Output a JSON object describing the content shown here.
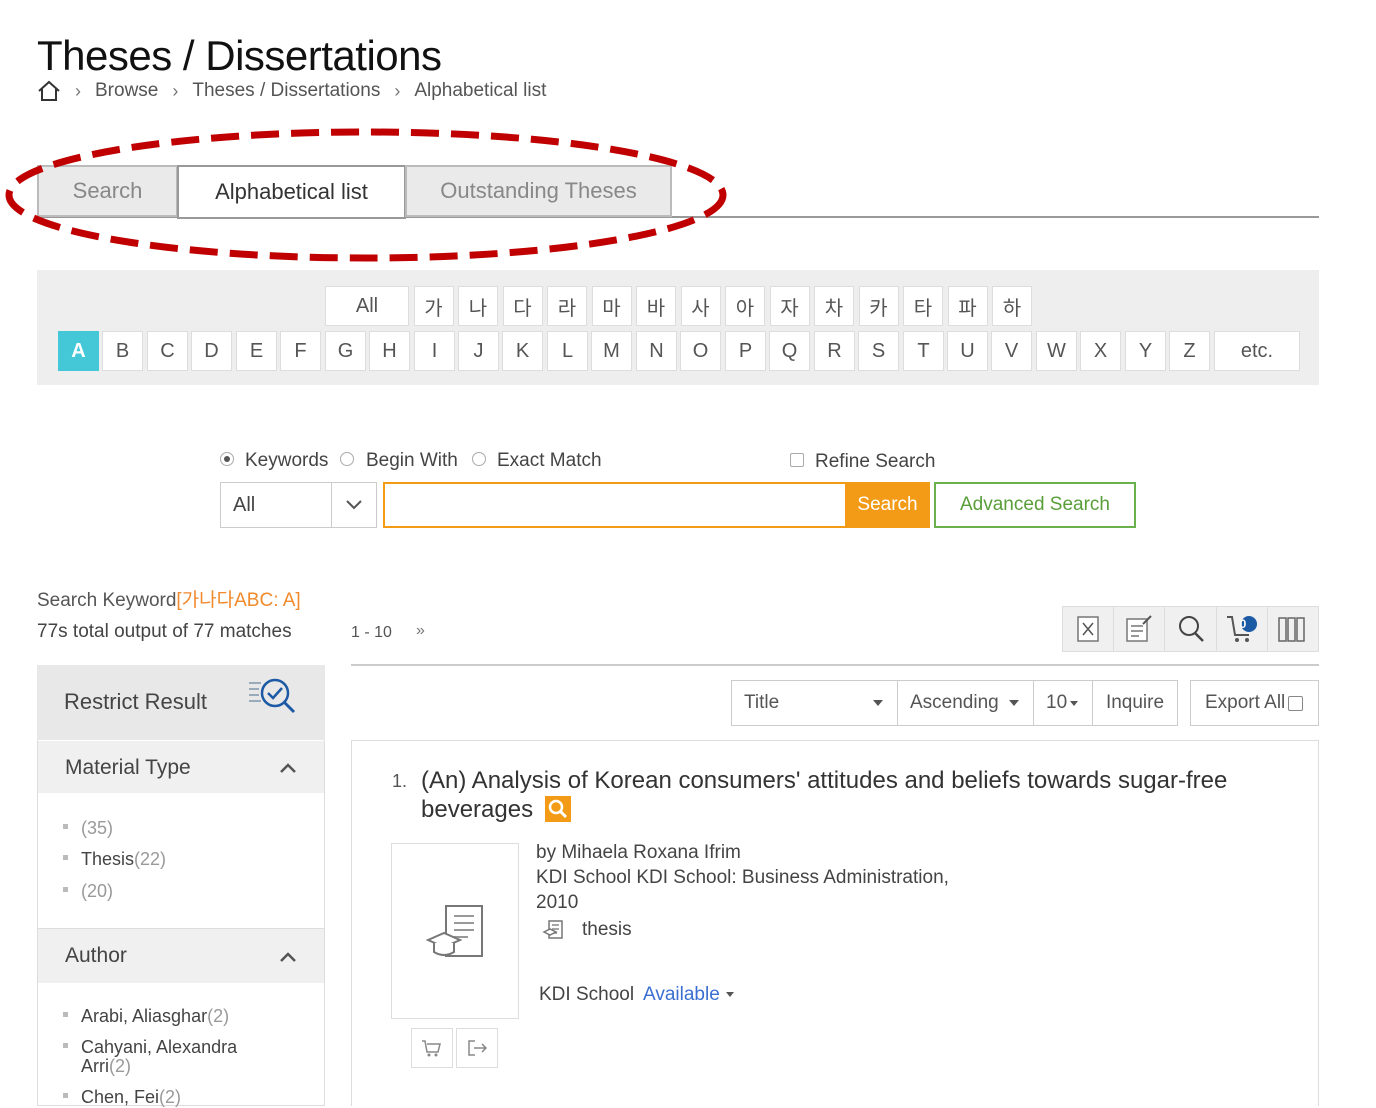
{
  "page": {
    "title": "Theses / Dissertations",
    "breadcrumb": {
      "home_icon": "home-icon",
      "items": [
        "Browse",
        "Theses / Dissertations",
        "Alphabetical list"
      ]
    }
  },
  "tabs": [
    {
      "label": "Search",
      "active": false
    },
    {
      "label": "Alphabetical list",
      "active": true
    },
    {
      "label": "Outstanding Theses",
      "active": false
    }
  ],
  "alphabet": {
    "korean": [
      "All",
      "가",
      "나",
      "다",
      "라",
      "마",
      "바",
      "사",
      "아",
      "자",
      "차",
      "카",
      "타",
      "파",
      "하"
    ],
    "latin": [
      "A",
      "B",
      "C",
      "D",
      "E",
      "F",
      "G",
      "H",
      "I",
      "J",
      "K",
      "L",
      "M",
      "N",
      "O",
      "P",
      "Q",
      "R",
      "S",
      "T",
      "U",
      "V",
      "W",
      "X",
      "Y",
      "Z",
      "etc."
    ],
    "selected": "A"
  },
  "search": {
    "modes": [
      "Keywords",
      "Begin With",
      "Exact Match"
    ],
    "selected_mode": "Keywords",
    "refine_label": "Refine Search",
    "scope_value": "All",
    "query": "",
    "search_label": "Search",
    "advanced_label": "Advanced Search"
  },
  "results": {
    "keyword_prefix": "Search Keyword",
    "keyword_value": "[가나다ABC: A]",
    "total_text_1": "77s total output of ",
    "total_count": "77",
    "total_text_2": " matches",
    "range": "1 - 10",
    "next_page": "»",
    "toolbar_icons": [
      "excel-export-icon",
      "edit-export-icon",
      "search-icon",
      "cart-icon",
      "bookshelf-icon"
    ],
    "cart_count": "0"
  },
  "sidebar": {
    "heading": "Restrict Result",
    "sections": [
      {
        "title": "Material Type",
        "items": [
          {
            "label": "",
            "count": "(35)"
          },
          {
            "label": "Thesis",
            "count": "(22)"
          },
          {
            "label": "",
            "count": "(20)"
          }
        ]
      },
      {
        "title": "Author",
        "items": [
          {
            "label": "Arabi, Aliasghar",
            "count": "(2)"
          },
          {
            "label": "Cahyani, Alexandra",
            "label2": "Arri",
            "count": "(2)"
          },
          {
            "label": "Chen, Fei",
            "count": "(2)"
          }
        ]
      }
    ]
  },
  "sort": {
    "field": "Title",
    "order": "Ascending",
    "per_page": "10",
    "inquire_label": "Inquire",
    "export_label": "Export All"
  },
  "record": {
    "number": "1.",
    "title": "(An) Analysis of Korean consumers' attitudes and beliefs towards sugar-free beverages",
    "author": "by Mihaela Roxana Ifrim",
    "publisher": "KDI School KDI School: Business Administration,",
    "year": "2010",
    "type": "thesis",
    "library": "KDI School",
    "availability": "Available"
  },
  "colors": {
    "accent_orange": "#f39b16",
    "selected_cyan": "#44c8d8",
    "green": "#6ab04c",
    "link_blue": "#3a6fd0",
    "annotation_red": "#c00000"
  }
}
